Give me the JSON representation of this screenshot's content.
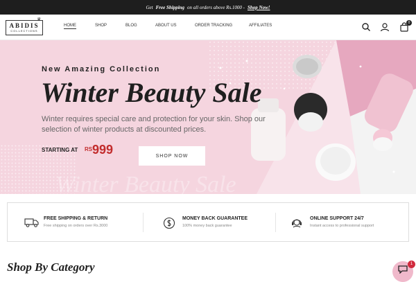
{
  "announcement": {
    "prefix": "Get",
    "highlight": "Free Shipping",
    "suffix": "on all orders above Rs.1000 -",
    "link": "Shop Now!"
  },
  "header": {
    "logo_text": "ABIDIS",
    "logo_sub": "COLLECTIONS",
    "nav": [
      "HOME",
      "SHOP",
      "BLOG",
      "ABOUT US",
      "ORDER TRACKING",
      "AFFILIATES"
    ],
    "cart_count": "0",
    "icons": [
      "search-icon",
      "user-icon",
      "cart-icon"
    ]
  },
  "hero": {
    "eyebrow": "New Amazing Collection",
    "title": "Winter Beauty Sale",
    "description": "Winter requires special care and protection for your skin. Shop our selection of winter products at discounted prices.",
    "starting_label": "STARTING AT",
    "currency": "RS",
    "price": "999",
    "button": "SHOP NOW",
    "background_color": "#f5d5df"
  },
  "features": [
    {
      "icon": "truck-icon",
      "title": "FREE SHIPPING & RETURN",
      "desc": "Free shipping on orders over Rs.3000"
    },
    {
      "icon": "money-back-icon",
      "title": "MONEY BACK GUARANTEE",
      "desc": "100% money back guarantee"
    },
    {
      "icon": "support-icon",
      "title": "ONLINE SUPPORT 24/7",
      "desc": "Instant access to professional support"
    }
  ],
  "section": {
    "title": "Shop By Category"
  },
  "chat": {
    "badge": "1"
  },
  "colors": {
    "accent_price": "#c22c2c",
    "topbar": "#1e1e1e",
    "chat_bubble": "#f0b9cb"
  }
}
